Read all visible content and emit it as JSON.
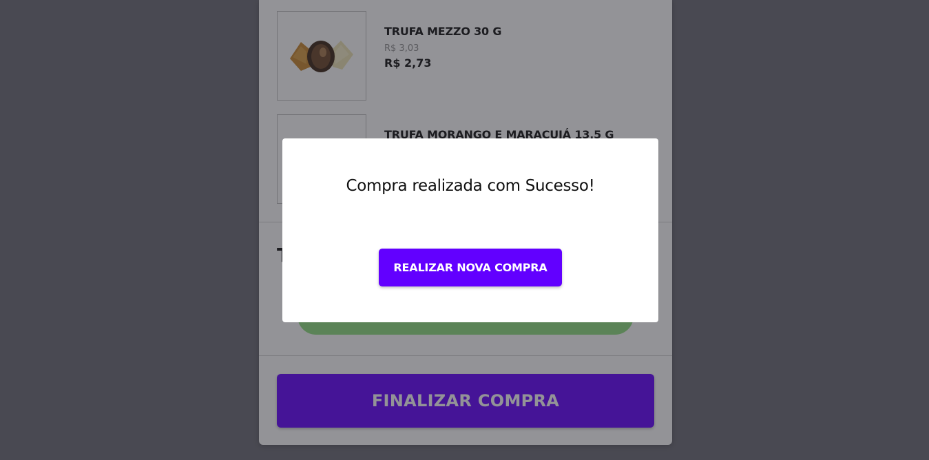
{
  "cart": {
    "items": [
      {
        "name": "TRUFA MEZZO 30 G",
        "old_price": "R$ 3,03",
        "price": "R$ 2,73",
        "image": "truffle-image"
      },
      {
        "name": "TRUFA MORANGO E MARACUJÁ 13,5 G",
        "image": "product-image"
      }
    ],
    "total_letter": "T",
    "finalize_label": "FINALIZAR COMPRA"
  },
  "modal": {
    "title": "Compra realizada com Sucesso!",
    "button_label": "REALIZAR NOVA COMPRA"
  },
  "colors": {
    "accent": "#6200ff",
    "shipping_pill": "#8fde7f",
    "overlay": "#6b6b74"
  }
}
